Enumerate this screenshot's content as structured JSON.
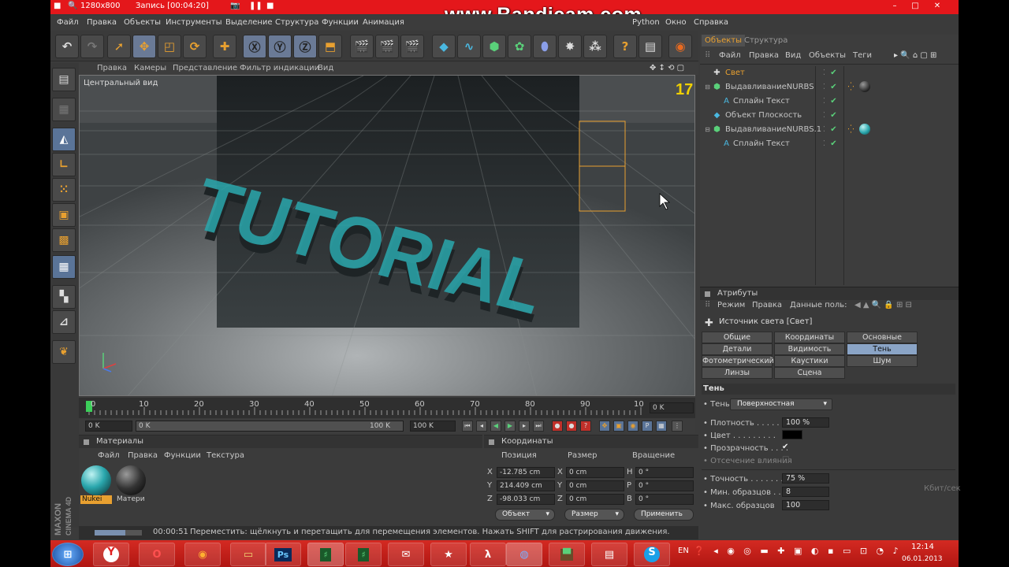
{
  "recorder": {
    "resolution": "1280x800",
    "record_label": "Запись [00:04:20]",
    "watermark": "www.Bandicam.com"
  },
  "menu": [
    "Файл",
    "Правка",
    "Объекты",
    "Инструменты",
    "Выделение",
    "Структура",
    "Функции",
    "Анимация",
    "Python",
    "Окно",
    "Справка"
  ],
  "viewport": {
    "menu": [
      "Правка",
      "Камеры",
      "Представление",
      "Фильтр индикации",
      "Вид"
    ],
    "label": "Центральный вид",
    "scene_text": "TUTORIAL"
  },
  "timeline": {
    "ticks": [
      "0",
      "10",
      "20",
      "30",
      "40",
      "50",
      "60",
      "70",
      "80",
      "90",
      "10"
    ],
    "current_frame_field": "0 K",
    "start_field": "0 K",
    "range_left": "0 K",
    "range_right": "100 K",
    "end_field": "100 K"
  },
  "materials": {
    "title": "Материалы",
    "menu": [
      "Файл",
      "Правка",
      "Функции",
      "Текстура"
    ],
    "items": [
      {
        "name": "Nukei",
        "color": "#2aa7ad"
      },
      {
        "name": "Матери",
        "color": "#333333"
      }
    ]
  },
  "coordinates": {
    "title": "Координаты",
    "headers": [
      "Позиция",
      "Размер",
      "Вращение"
    ],
    "rows": [
      {
        "pos_axis": "X",
        "pos": "-12.785 cm",
        "size_axis": "X",
        "size": "0 cm",
        "rot_axis": "H",
        "rot": "0 °"
      },
      {
        "pos_axis": "Y",
        "pos": "214.409 cm",
        "size_axis": "Y",
        "size": "0 cm",
        "rot_axis": "P",
        "rot": "0 °"
      },
      {
        "pos_axis": "Z",
        "pos": "-98.033 cm",
        "size_axis": "Z",
        "size": "0 cm",
        "rot_axis": "B",
        "rot": "0 °"
      }
    ],
    "mode_object": "Объект",
    "mode_size": "Размер",
    "apply": "Применить"
  },
  "status": {
    "time": "00:00:51",
    "text": "Переместить: щёлкнуть и перетащить для перемещения элементов. Нажать SHIFT для растрирования движения."
  },
  "objects": {
    "tabs": [
      "Объекты",
      "Структура"
    ],
    "menu": [
      "Файл",
      "Правка",
      "Вид",
      "Объекты",
      "Теги"
    ],
    "items": [
      {
        "name": "Свет",
        "indent": 0,
        "kind": "light",
        "selected": true
      },
      {
        "name": "ВыдавливаниеNURBS",
        "indent": 0,
        "kind": "nurbs",
        "selected": false
      },
      {
        "name": "Сплайн Текст",
        "indent": 1,
        "kind": "text",
        "selected": false
      },
      {
        "name": "Объект Плоскость",
        "indent": 0,
        "kind": "plane",
        "selected": false
      },
      {
        "name": "ВыдавливаниеNURBS.1",
        "indent": 0,
        "kind": "nurbs",
        "selected": false
      },
      {
        "name": "Сплайн Текст",
        "indent": 1,
        "kind": "text",
        "selected": false
      }
    ]
  },
  "attributes": {
    "title": "Атрибуты",
    "menu": [
      "Режим",
      "Правка",
      "Данные поль:"
    ],
    "object_title": "Источник света [Свет]",
    "tabs": [
      [
        "Общие",
        "Координаты",
        "Основные"
      ],
      [
        "Детали",
        "Видимость",
        "Тень"
      ],
      [
        "Фотометрический",
        "Каустики",
        "Шум"
      ],
      [
        "Линзы",
        "Сцена"
      ]
    ],
    "active_tab": "Тень",
    "section": "Тень",
    "shadow_label": "Тень",
    "shadow_value": "Поверхностная",
    "density_label": "Плотность",
    "density_value": "100 %",
    "color_label": "Цвет",
    "transparency_label": "Прозрачность",
    "clip_label": "Отсечение влияния",
    "accuracy_label": "Точность",
    "accuracy_value": "75 %",
    "min_samples_label": "Мин. образцов",
    "min_samples_value": "8",
    "max_samples_label": "Макс. образцов",
    "max_samples_value": "100",
    "network_label": "Кбит/сек"
  },
  "tray": {
    "lang": "EN",
    "time": "12:14",
    "date": "06.01.2013"
  },
  "colors": {
    "accent_blue": "#8aa4c6",
    "recorder_red": "#e4171b",
    "teal": "#2aa7ad",
    "selection_orange": "#e8a030"
  }
}
